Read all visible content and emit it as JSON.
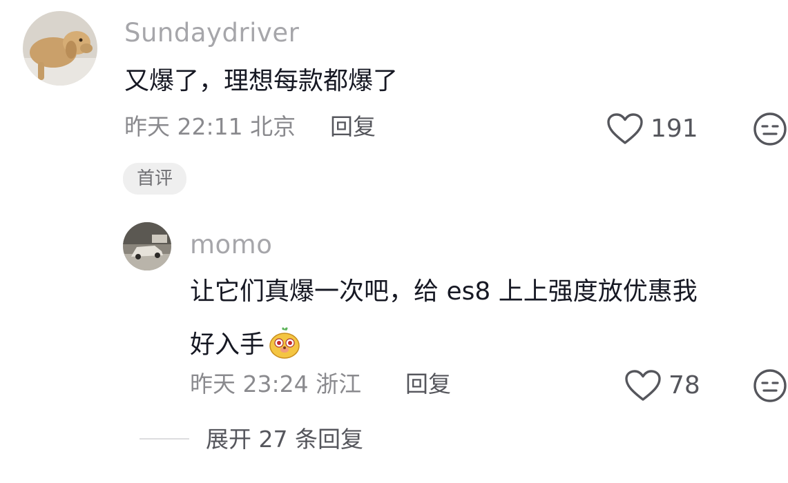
{
  "comments": [
    {
      "username": "Sundaydriver",
      "avatar": "dog-photo",
      "text": "又爆了，理想每款都爆了",
      "date": "昨天",
      "time": "22:11",
      "location": "北京",
      "reply_label": "回复",
      "likes": "191",
      "badge": "首评"
    },
    {
      "username": "momo",
      "avatar": "car-photo",
      "text_line1": "让它们真爆一次吧，给 es8 上上强度放优惠我",
      "text_line2": "好入手",
      "emoji": "mole-emoji",
      "date": "昨天",
      "time": "23:24",
      "location": "浙江",
      "reply_label": "回复",
      "likes": "78"
    }
  ],
  "expand": {
    "label": "展开 27 条回复"
  },
  "icons": {
    "like": "heart-outline-icon",
    "reaction": "neutral-face-icon"
  }
}
